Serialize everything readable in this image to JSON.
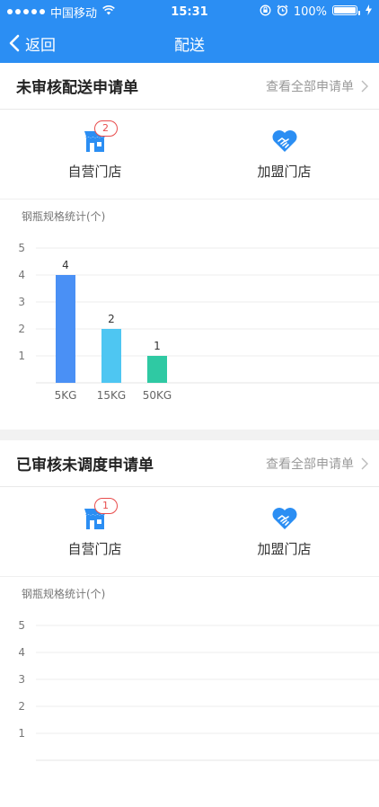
{
  "status_bar": {
    "carrier": "中国移动",
    "time": "15:31",
    "battery": "100%"
  },
  "nav": {
    "back_label": "返回",
    "title": "配送"
  },
  "sections": [
    {
      "title": "未审核配送申请单",
      "view_all": "查看全部申请单",
      "stores": [
        {
          "label": "自营门店",
          "badge": "2"
        },
        {
          "label": "加盟门店"
        }
      ],
      "chart_title": "钢瓶规格统计(个)"
    },
    {
      "title": "已审核未调度申请单",
      "view_all": "查看全部申请单",
      "stores": [
        {
          "label": "自营门店",
          "badge": "1"
        },
        {
          "label": "加盟门店"
        }
      ],
      "chart_title": "钢瓶规格统计(个)"
    }
  ],
  "chart_data": [
    {
      "type": "bar",
      "categories": [
        "5KG",
        "15KG",
        "50KG"
      ],
      "values": [
        4,
        2,
        1
      ],
      "colors": [
        "#4a90f5",
        "#4ec6f2",
        "#2fc9a3"
      ],
      "ylim": [
        0,
        5
      ],
      "yticks": [
        1,
        2,
        3,
        4,
        5
      ],
      "grid": true
    },
    {
      "type": "bar",
      "categories": [],
      "values": [],
      "ylim": [
        0,
        5
      ],
      "yticks": [
        1,
        2,
        3,
        4,
        5
      ],
      "grid": true
    }
  ],
  "colors": {
    "primary": "#2b8ef3",
    "icon": "#2b8ef3",
    "badge": "#e84d4d"
  }
}
